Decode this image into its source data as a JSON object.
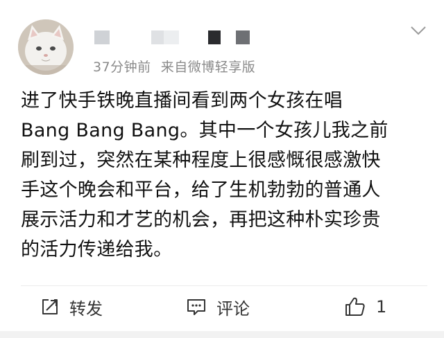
{
  "post": {
    "meta": {
      "time": "37分钟前",
      "source": "来自微博轻享版"
    },
    "content_lines": [
      "进了快手铁晚直播间看到两个女孩在唱",
      "Bang Bang Bang。其中一个女孩儿我之前",
      "刷到过，突然在某种程度上很感慨很感激快",
      "手这个晚会和平台，给了生机勃勃的普通人",
      "展示活力和才艺的机会，再把这种朴实珍贵",
      "的活力传递给我。"
    ],
    "actions": {
      "repost_label": "转发",
      "comment_label": "评论",
      "like_count": "1"
    },
    "icons": {
      "menu": "chevron-down-icon",
      "repost": "repost-icon",
      "comment": "comment-icon",
      "like": "thumbs-up-icon"
    }
  }
}
